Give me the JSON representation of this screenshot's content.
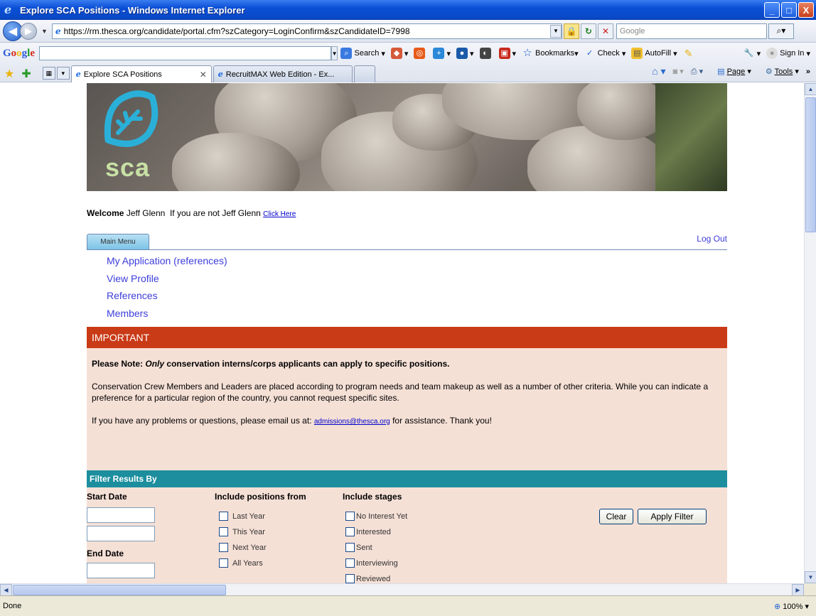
{
  "window": {
    "title": "Explore SCA Positions - Windows Internet Explorer",
    "min": "_",
    "max": "□",
    "close": "X"
  },
  "address": {
    "url": "https://rm.thesca.org/candidate/portal.cfm?szCategory=LoginConfirm&szCandidateID=7998",
    "search_placeholder": "Google"
  },
  "google_toolbar": {
    "search_label": "Search",
    "bookmarks_label": "Bookmarks",
    "check_label": "Check",
    "autofill_label": "AutoFill",
    "signin_label": "Sign In"
  },
  "tabs": [
    {
      "label": "Explore SCA Positions",
      "active": true
    },
    {
      "label": "RecruitMAX Web Edition - Ex...",
      "active": false
    }
  ],
  "commands": {
    "page_label": "Page",
    "tools_label": "Tools"
  },
  "page": {
    "logo_text": "sca",
    "welcome_label": "Welcome",
    "user_name": "Jeff Glenn",
    "not_you_text": "If you are not Jeff Glenn",
    "click_here": "Click Here",
    "main_menu_tab": "Main Menu",
    "logout": "Log Out",
    "menu_links": [
      "My Application (references)",
      "View Profile",
      "References",
      "Members"
    ],
    "important_title": "IMPORTANT",
    "note_prefix": "Please Note:",
    "note_only": "Only",
    "note_rest": "conservation interns/corps applicants can apply to specific positions.",
    "crew_text": "Conservation Crew Members and Leaders are placed according to program needs and team makeup as well as a number of other criteria. While you can indicate a preference for a particular region of the country, you cannot request specific sites.",
    "contact_prefix": "If you have any problems or questions, please email us at:",
    "contact_email": "admissions@thesca.org",
    "contact_suffix": "for assistance. Thank you!",
    "filter_title": "Filter Results By",
    "start_date": "Start Date",
    "end_date": "End Date",
    "positions_title": "Include positions from",
    "positions": [
      "Last Year",
      "This Year",
      "Next Year",
      "All Years"
    ],
    "stages_title": "Include stages",
    "stages": [
      "No Interest Yet",
      "Interested",
      "Sent",
      "Interviewing",
      "Reviewed"
    ],
    "clear_btn": "Clear",
    "apply_btn": "Apply Filter"
  },
  "status": {
    "text": "Done",
    "zoom": "100%"
  }
}
